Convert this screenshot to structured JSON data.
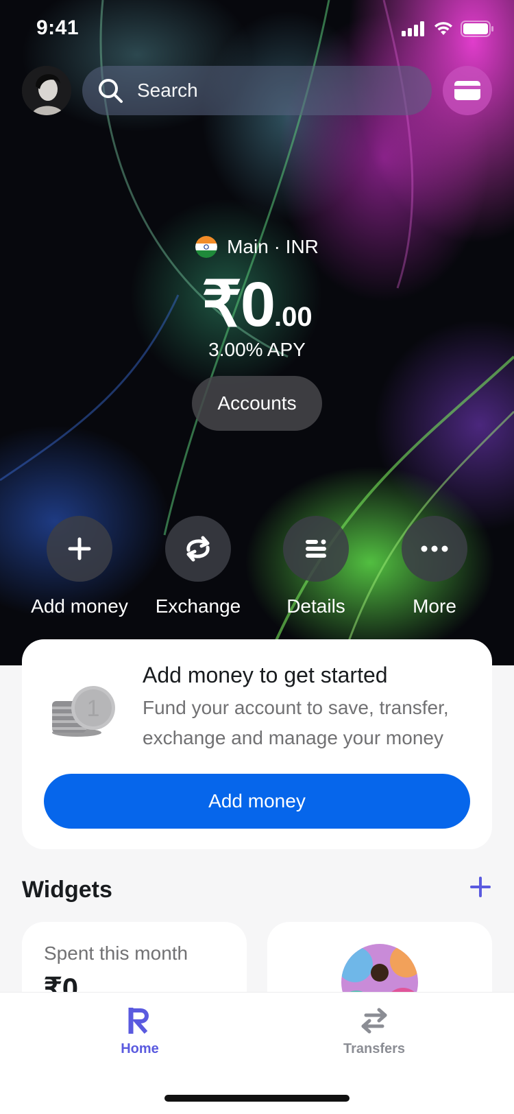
{
  "status_bar": {
    "time": "9:41"
  },
  "header": {
    "search_placeholder": "Search"
  },
  "balance": {
    "account_label": "Main · INR",
    "main": "₹0",
    "decimals": ".00",
    "apy": "3.00% APY",
    "accounts_button": "Accounts"
  },
  "actions": [
    {
      "label": "Add money",
      "icon": "plus-icon"
    },
    {
      "label": "Exchange",
      "icon": "exchange-icon"
    },
    {
      "label": "Details",
      "icon": "details-icon"
    },
    {
      "label": "More",
      "icon": "more-icon"
    }
  ],
  "promo": {
    "title": "Add money to get started",
    "text": "Fund your account to save, transfer, exchange and manage your money",
    "button": "Add money"
  },
  "widgets": {
    "title": "Widgets",
    "spent_label": "Spent this month",
    "spent_value": "₹0"
  },
  "tabbar": {
    "tabs": [
      {
        "label": "Home",
        "active": true
      },
      {
        "label": "Transfers",
        "active": false
      }
    ]
  },
  "colors": {
    "accent_blue": "#0666eb",
    "tab_active": "#5a5adf",
    "tab_inactive": "#8b8d94",
    "card_button": "#c850be"
  }
}
